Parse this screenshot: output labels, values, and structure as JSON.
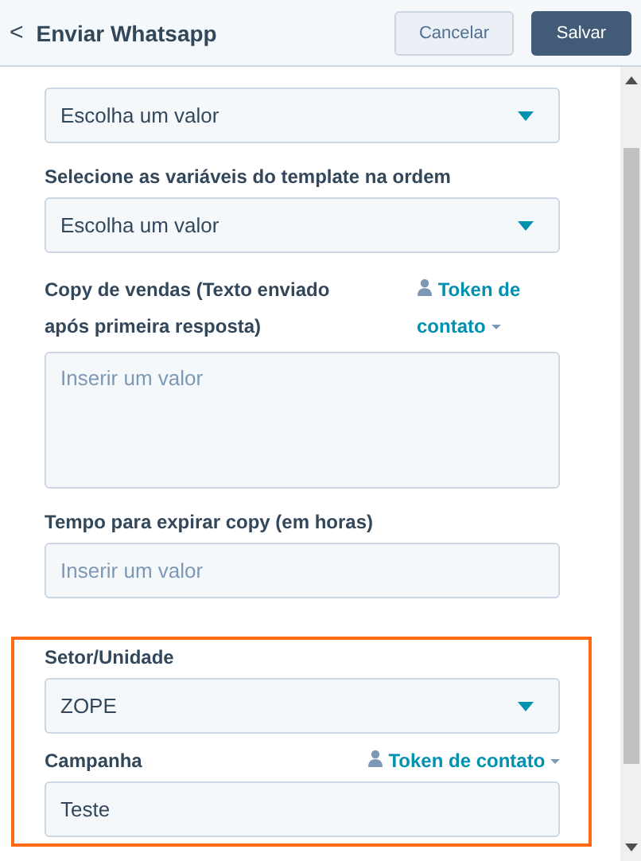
{
  "header": {
    "back_icon": "<",
    "title": "Enviar Whatsapp",
    "buttons": [
      {
        "label": "Cancelar",
        "kind": "secondary"
      },
      {
        "label": "Salvar",
        "kind": "primary"
      }
    ]
  },
  "sections": [
    {
      "highlighted": false,
      "fields": [
        {
          "kind": "select",
          "value": "Escolha um valor"
        },
        {
          "kind": "select",
          "label": "Selecione as variáveis do template na ordem",
          "value": "Escolha um valor"
        },
        {
          "kind": "textarea",
          "label": "Copy de vendas (Texto enviado após primeira resposta)",
          "token": "Token de contato",
          "placeholder": "Inserir um valor"
        },
        {
          "kind": "input",
          "label": "Tempo para expirar copy (em horas)",
          "placeholder": "Inserir um valor"
        }
      ]
    },
    {
      "highlighted": true,
      "fields": [
        {
          "kind": "select",
          "label": "Setor/Unidade",
          "value": "ZOPE"
        },
        {
          "kind": "input",
          "label": "Campanha",
          "token": "Token de contato",
          "value": "Teste"
        }
      ]
    }
  ]
}
